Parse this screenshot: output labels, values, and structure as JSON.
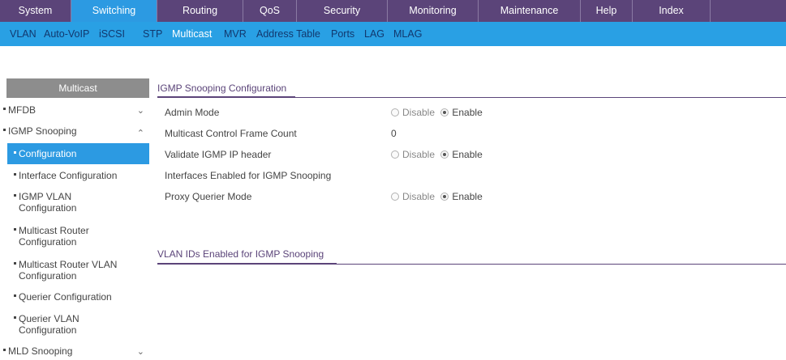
{
  "top_nav": [
    {
      "label": "System"
    },
    {
      "label": "Switching",
      "active": true
    },
    {
      "label": "Routing"
    },
    {
      "label": "QoS"
    },
    {
      "label": "Security"
    },
    {
      "label": "Monitoring"
    },
    {
      "label": "Maintenance"
    },
    {
      "label": "Help"
    },
    {
      "label": "Index"
    }
  ],
  "sub_nav": [
    {
      "label": "VLAN"
    },
    {
      "label": "Auto-VoIP"
    },
    {
      "label": "iSCSI"
    },
    {
      "label": "STP"
    },
    {
      "label": "Multicast",
      "active": true
    },
    {
      "label": "MVR"
    },
    {
      "label": "Address Table"
    },
    {
      "label": "Ports"
    },
    {
      "label": "LAG"
    },
    {
      "label": "MLAG"
    }
  ],
  "sidebar": {
    "header": "Multicast",
    "items": [
      {
        "label": "MFDB",
        "chevron": "chevron-down-icon"
      },
      {
        "label": "IGMP Snooping",
        "chevron": "chevron-up-icon"
      },
      {
        "label": "Configuration",
        "active": true
      },
      {
        "label": "Interface Configuration"
      },
      {
        "label": "IGMP VLAN Configuration"
      },
      {
        "label": "Multicast Router Configuration"
      },
      {
        "label": "Multicast Router VLAN Configuration"
      },
      {
        "label": "Querier Configuration"
      },
      {
        "label": "Querier VLAN Configuration"
      },
      {
        "label": "MLD Snooping",
        "chevron": "chevron-down-icon"
      }
    ]
  },
  "main": {
    "section1_title": "IGMP Snooping Configuration",
    "rows": [
      {
        "label": "Admin Mode",
        "disable": "Disable",
        "enable": "Enable",
        "selected": "Enable"
      },
      {
        "label": "Multicast Control Frame Count",
        "value": "0"
      },
      {
        "label": "Validate IGMP IP header",
        "disable": "Disable",
        "enable": "Enable",
        "selected": "Enable"
      },
      {
        "label": "Interfaces Enabled for IGMP Snooping"
      },
      {
        "label": "Proxy Querier Mode",
        "disable": "Disable",
        "enable": "Enable",
        "selected": "Enable"
      }
    ],
    "section2_title": "VLAN IDs Enabled for IGMP Snooping"
  },
  "colors": {
    "top_nav_bg": "#5b4479",
    "accent_blue": "#2c9ae2",
    "sub_nav_bg": "#29a0e4",
    "sidebar_header_bg": "#8d8d8d",
    "section_rule": "#5b4479"
  }
}
